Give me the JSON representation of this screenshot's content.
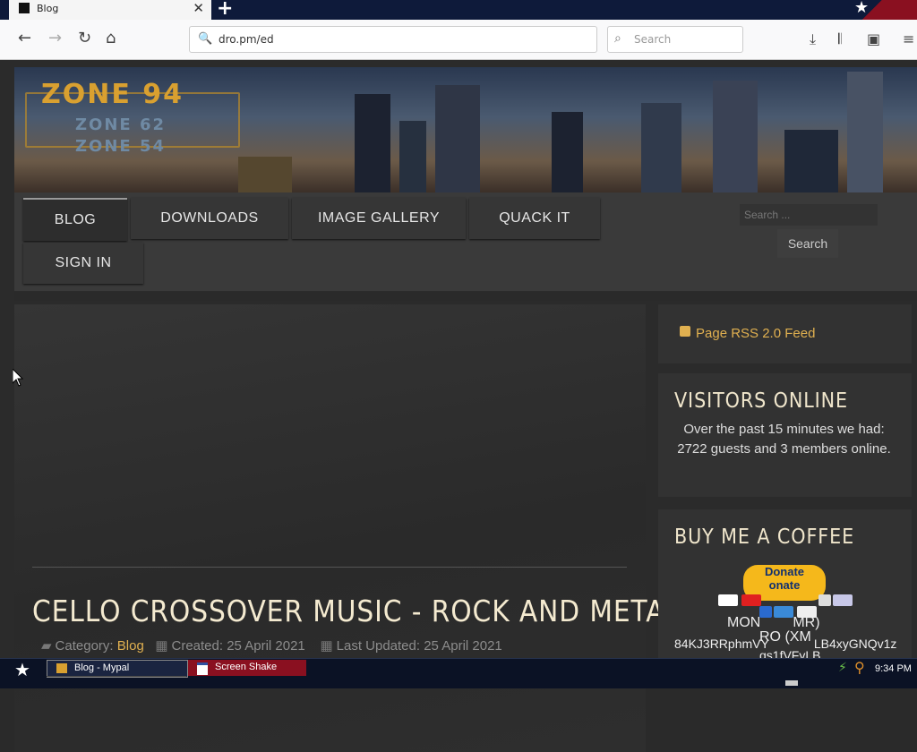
{
  "browser": {
    "tab_title": "Blog",
    "new_tab_label": "+",
    "url": "dro.pm/ed",
    "search_placeholder": "Search"
  },
  "site": {
    "logo_main": "ZONE 94",
    "logo_sub1": "ZONE 62",
    "logo_sub2": "ZONE 54",
    "menu": [
      "BLOG",
      "DOWNLOADS",
      "IMAGE GALLERY",
      "QUACK IT",
      "SIGN IN"
    ],
    "search_placeholder": "Search ...",
    "search_button": "Search"
  },
  "article": {
    "title": "CELLO CROSSOVER MUSIC - ROCK AND METAL",
    "category_label": "Category:",
    "category": "Blog",
    "created": "Created: 25 April 2021",
    "updated": "Last Updated: 25 April 2021"
  },
  "sidebar": {
    "rss": "Page RSS 2.0 Feed",
    "visitors_heading": "VISITORS ONLINE",
    "visitors_text": "Over the past 15 minutes we had: 2722 guests and 3 members online.",
    "coffee_heading": "BUY ME A COFFEE",
    "donate_top": "Donate",
    "donate_bottom": "onate",
    "monero_line1": "MON",
    "monero_line1b": "MR)",
    "monero_line2": "RO (XM",
    "address_line1": "84KJ3RRphmVY",
    "address_line1b": "LB4xyGNQv1z",
    "address_line2": "qs1fVFyLB"
  },
  "taskbar": {
    "task1": "Blog - Mypal",
    "task2": "Screen Shake",
    "clock": "9:34 PM"
  },
  "colors": {
    "accent": "#e0b050",
    "taskbar": "#0b1225",
    "tab_strip": "#0e1a3a"
  }
}
